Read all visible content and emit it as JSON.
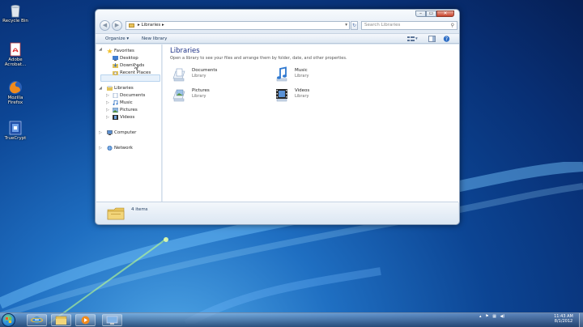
{
  "desktop_icons": [
    {
      "label": "Recycle Bin",
      "icon": "recycle-bin-icon"
    },
    {
      "label": "Adobe Acrobat...",
      "icon": "adobe-acrobat-icon"
    },
    {
      "label": "Mozilla Firefox",
      "icon": "firefox-icon"
    },
    {
      "label": "TrueCrypt",
      "icon": "truecrypt-icon"
    }
  ],
  "window": {
    "address": {
      "segment": "Libraries",
      "separator": "▸"
    },
    "search_placeholder": "Search Libraries",
    "toolbar": {
      "organize": "Organize ▾",
      "new_library": "New library"
    },
    "nav": {
      "favorites": "Favorites",
      "favorites_items": [
        "Desktop",
        "Downloads",
        "Recent Places"
      ],
      "libraries": "Libraries",
      "libraries_items": [
        "Documents",
        "Music",
        "Pictures",
        "Videos"
      ],
      "computer": "Computer",
      "network": "Network"
    },
    "content": {
      "title": "Libraries",
      "subtitle": "Open a library to see your files and arrange them by folder, date, and other properties.",
      "libraries": [
        {
          "name": "Documents",
          "type": "Library",
          "icon": "documents-library-icon"
        },
        {
          "name": "Music",
          "type": "Library",
          "icon": "music-library-icon"
        },
        {
          "name": "Pictures",
          "type": "Library",
          "icon": "pictures-library-icon"
        },
        {
          "name": "Videos",
          "type": "Library",
          "icon": "videos-library-icon"
        }
      ]
    },
    "details": {
      "count": "4 items"
    }
  },
  "taskbar": {
    "pinned": [
      "internet-explorer-icon",
      "windows-explorer-icon",
      "media-player-icon",
      "remote-desktop-icon"
    ],
    "time": "11:43 AM",
    "date": "8/1/2012"
  },
  "colors": {
    "accent": "#1e3287",
    "desktop": "#0c4594",
    "selection": "#e7f1fb"
  }
}
